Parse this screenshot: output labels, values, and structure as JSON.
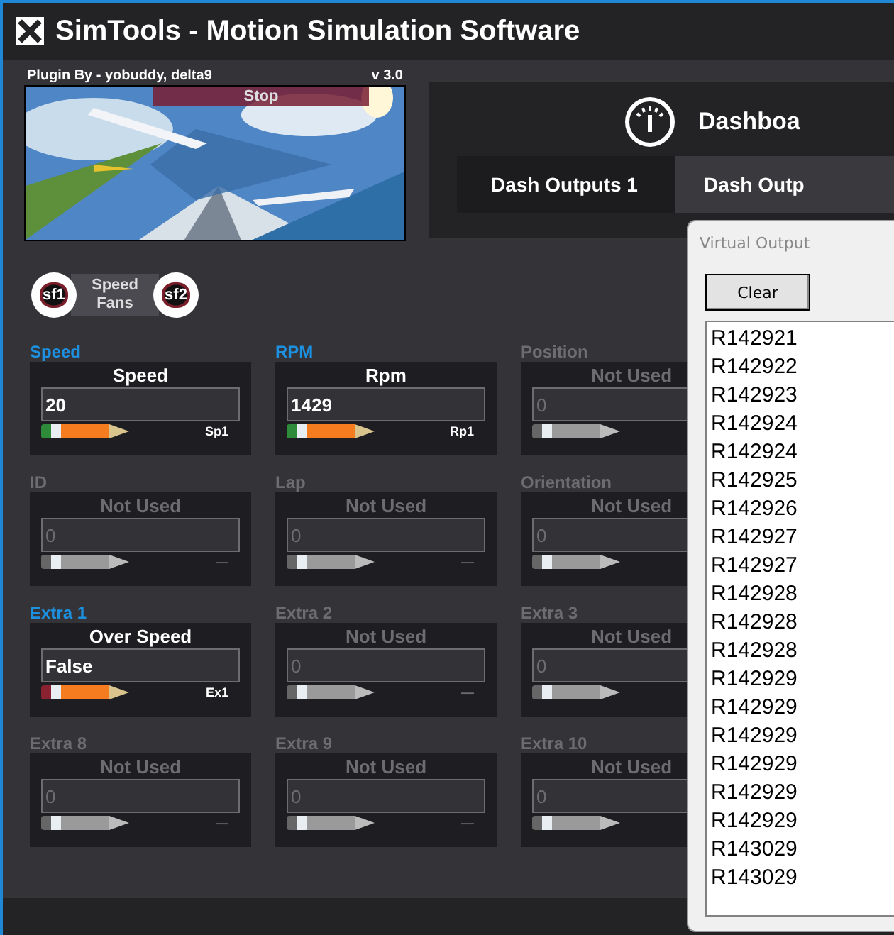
{
  "window": {
    "title": "SimTools - Motion Simulation Software"
  },
  "plugin": {
    "author": "Plugin By - yobuddy, delta9",
    "version": "v 3.0",
    "stop_button": "Stop"
  },
  "dashboard": {
    "title": "Dashboa",
    "tabs": [
      {
        "label": "Dash Outputs 1",
        "selected": true
      },
      {
        "label": "Dash Outp",
        "selected": false
      }
    ]
  },
  "speed_fans": {
    "label": "Speed Fans",
    "fans": [
      "sf1",
      "sf2"
    ]
  },
  "channels": [
    {
      "label": "Speed",
      "active": true,
      "name": "Speed",
      "value": "20",
      "color": "#2e8b3a",
      "readout": "Sp1"
    },
    {
      "label": "RPM",
      "active": true,
      "name": "Rpm",
      "value": "1429",
      "color": "#2e8b3a",
      "readout": "Rp1"
    },
    {
      "label": "Position",
      "active": false,
      "name": "Not Used",
      "value": "0"
    },
    {
      "label": "ID",
      "active": false,
      "name": "Not Used",
      "value": "0",
      "readout": "—"
    },
    {
      "label": "Lap",
      "active": false,
      "name": "Not Used",
      "value": "0",
      "readout": "—"
    },
    {
      "label": "Orientation",
      "active": false,
      "name": "Not Used",
      "value": "0"
    },
    {
      "label": "Extra 1",
      "active": true,
      "name": "Over Speed",
      "value": "False",
      "color": "#8b2232",
      "readout": "Ex1"
    },
    {
      "label": "Extra 2",
      "active": false,
      "name": "Not Used",
      "value": "0",
      "readout": "—"
    },
    {
      "label": "Extra 3",
      "active": false,
      "name": "Not Used",
      "value": "0"
    },
    {
      "label": "Extra 8",
      "active": false,
      "name": "Not Used",
      "value": "0",
      "readout": "—"
    },
    {
      "label": "Extra 9",
      "active": false,
      "name": "Not Used",
      "value": "0",
      "readout": "—"
    },
    {
      "label": "Extra 10",
      "active": false,
      "name": "Not Used",
      "value": "0"
    }
  ],
  "virtual_output": {
    "title": "Virtual Output",
    "clear_button": "Clear",
    "lines": [
      "R142921",
      "R142922",
      "R142923",
      "R142924",
      "R142924",
      "R142925",
      "R142926",
      "R142927",
      "R142927",
      "R142928",
      "R142928",
      "R142928",
      "R142929",
      "R142929",
      "R142929",
      "R142929",
      "R142929",
      "R142929",
      "R143029",
      "R143029"
    ]
  }
}
